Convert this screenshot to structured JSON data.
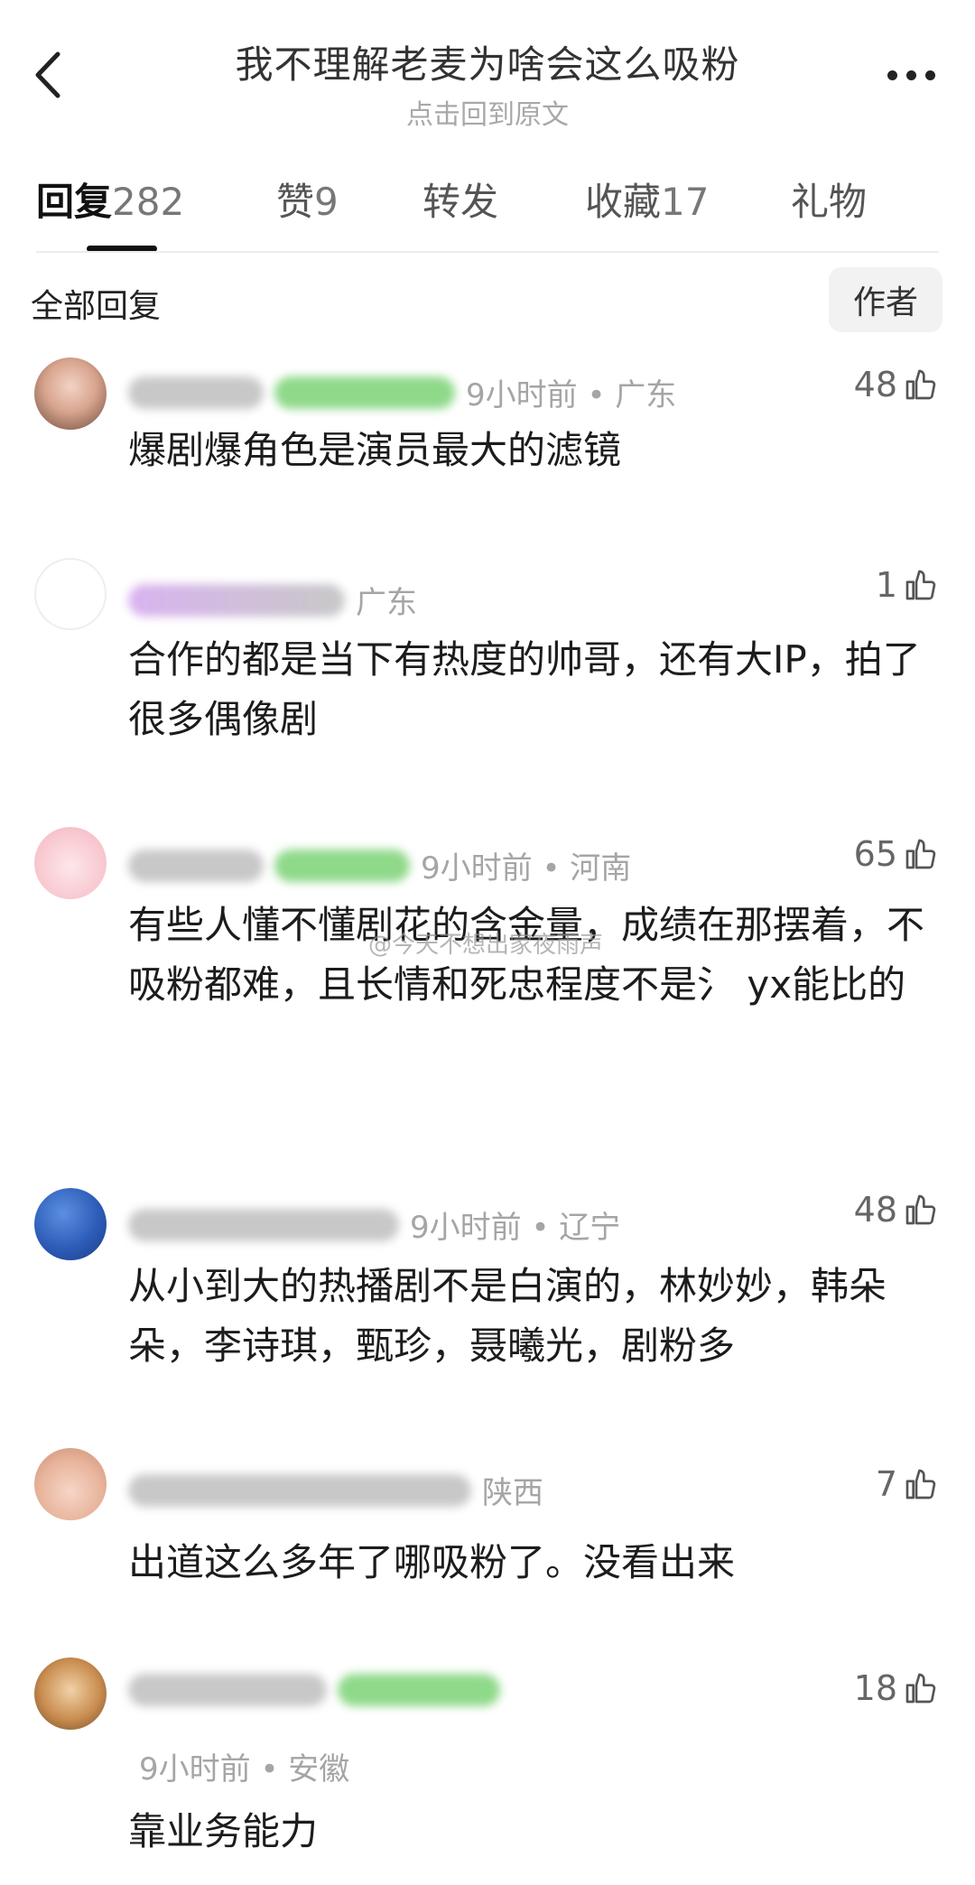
{
  "header": {
    "title": "我不理解老麦为啥会这么吸粉",
    "subtitle": "点击回到原文"
  },
  "tabs": [
    {
      "label": "回复",
      "count": "282"
    },
    {
      "label": "赞",
      "count": "9"
    },
    {
      "label": "转发",
      "count": ""
    },
    {
      "label": "收藏",
      "count": "17"
    },
    {
      "label": "礼物",
      "count": ""
    }
  ],
  "section": {
    "title": "全部回复",
    "author_button": "作者"
  },
  "comments": [
    {
      "meta": "9小时前 • 广东",
      "likes": "48",
      "text": "爆剧爆角色是演员最大的滤镜"
    },
    {
      "meta": "广东",
      "likes": "1",
      "text": "合作的都是当下有热度的帅哥，还有大IP，拍了很多偶像剧"
    },
    {
      "meta": "9小时前 • 河南",
      "likes": "65",
      "text": "有些人懂不懂剧花的含金量，成绩在那摆着，不吸粉都难，且长情和死忠程度不是氵 yx能比的"
    },
    {
      "meta": "9小时前 • 辽宁",
      "likes": "48",
      "text": "从小到大的热播剧不是白演的，林妙妙，韩朵朵，李诗琪，甄珍，聂曦光，剧粉多"
    },
    {
      "meta": "陕西",
      "likes": "7",
      "text": "出道这么多年了哪吸粉了。没看出来"
    },
    {
      "meta": "9小时前 • 安徽",
      "likes": "18",
      "text": "靠业务能力"
    }
  ],
  "watermark": "@今天不想出家夜雨声",
  "icons": {
    "back": "chevron-left-icon",
    "more": "more-dots-icon",
    "like": "thumbs-up-icon"
  }
}
